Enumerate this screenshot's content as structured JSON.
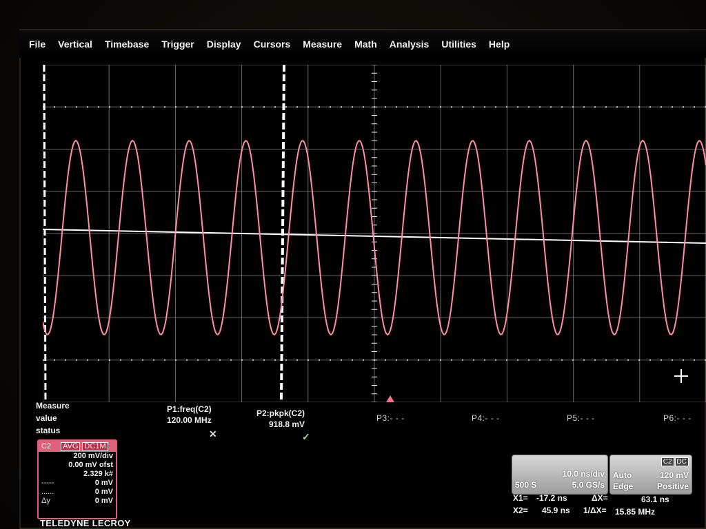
{
  "menu": [
    "File",
    "Vertical",
    "Timebase",
    "Trigger",
    "Display",
    "Cursors",
    "Measure",
    "Math",
    "Analysis",
    "Utilities",
    "Help"
  ],
  "channel_marker": "C2",
  "waveform": {
    "color": "#ff8fa3",
    "cycles": 11.7,
    "peak_to_peak_divs": 4.6
  },
  "measure": {
    "labels": [
      "Measure",
      "value",
      "status"
    ],
    "p1": {
      "name": "P1:freq(C2)",
      "value": "120.00 MHz",
      "status": "✕"
    },
    "p2": {
      "name": "P2:pkpk(C2)",
      "value": "918.8 mV",
      "status": "✓"
    },
    "p3": "P3:- - -",
    "p4": "P4:- - -",
    "p5": "P5:- - -",
    "p6": "P6:- - -"
  },
  "channel_descriptor": {
    "channel": "C2",
    "avg": "AVG",
    "coupling": "DC1M",
    "rows": [
      {
        "label": "",
        "value": "200 mV/div"
      },
      {
        "label": "",
        "value": "0.00 mV ofst"
      },
      {
        "label": "",
        "value": "2.329 k#"
      },
      {
        "label": "-----",
        "value": "0 mV"
      },
      {
        "label": "......",
        "value": "0 mV"
      },
      {
        "label": "Δy",
        "value": "0 mV"
      }
    ]
  },
  "brand": "TELEDYNE LECROY",
  "timebase": {
    "div": "10.0 ns/div",
    "samples": "500 S",
    "rate": "5.0 GS/s"
  },
  "trigger": {
    "channel": "C2",
    "coupling": "DC",
    "mode": "Auto",
    "level": "120 mV",
    "type": "Edge",
    "slope": "Positive"
  },
  "cursors": {
    "x1_label": "X1=",
    "x1": "-17.2 ns",
    "x2_label": "X2=",
    "x2": "45.9 ns",
    "dx_label": "ΔX=",
    "dx": "63.1 ns",
    "inv_dx_label": "1/ΔX=",
    "inv_dx": "15.85 MHz"
  },
  "colors": {
    "trace": "#ff8fa3",
    "channel": "#e0607a",
    "grid": "#bdbdbd",
    "cursor": "#ffffff"
  }
}
